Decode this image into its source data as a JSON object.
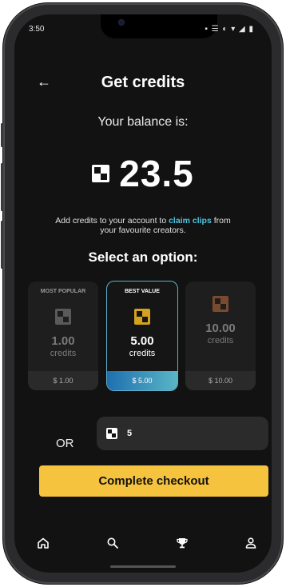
{
  "status": {
    "time": "3:50",
    "right_icons": "▪ ☰ ◐ ▾ ◢ ▮"
  },
  "header": {
    "back_icon": "←",
    "title": "Get credits"
  },
  "balance": {
    "label": "Your balance is:",
    "value": "23.5"
  },
  "info": {
    "before": "Add credits to your account to ",
    "highlight": "claim clips",
    "after": " from your favourite creators."
  },
  "select_title": "Select an option:",
  "options": [
    {
      "badge": "MOST POPULAR",
      "amount": "1.00",
      "unit": "credits",
      "price": "$ 1.00",
      "icon_color": "#5a5a5a",
      "selected": false
    },
    {
      "badge": "BEST VALUE",
      "amount": "5.00",
      "unit": "credits",
      "price": "$ 5.00",
      "icon_color": "#d3a21e",
      "selected": true
    },
    {
      "badge": "",
      "amount": "10.00",
      "unit": "credits",
      "price": "$ 10.00",
      "icon_color": "#7a4a2e",
      "selected": false
    }
  ],
  "custom": {
    "or_label": "OR",
    "value": "5"
  },
  "checkout_label": "Complete checkout",
  "nav": [
    "home-icon",
    "search-icon",
    "trophy-icon",
    "profile-icon"
  ],
  "colors": {
    "accent_yellow": "#f6c33e",
    "link_cyan": "#4fc3e0",
    "background": "#121212"
  }
}
